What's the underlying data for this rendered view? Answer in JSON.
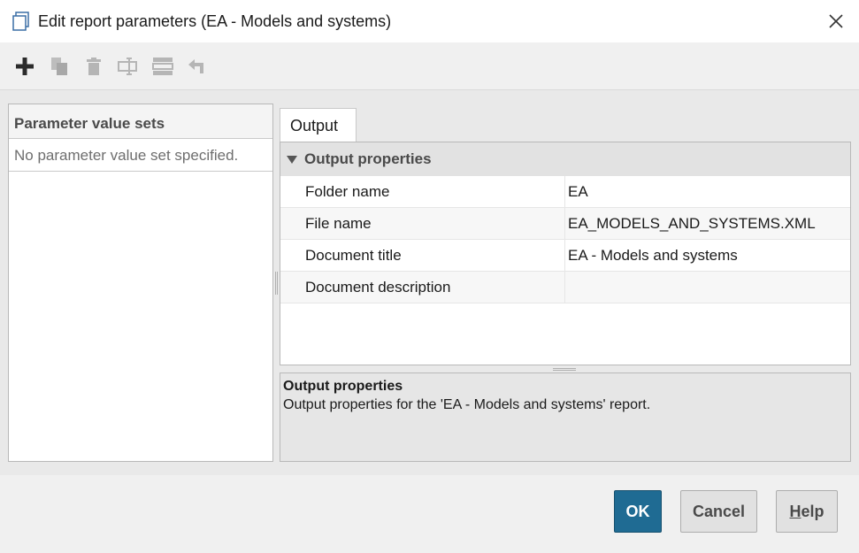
{
  "window": {
    "title": "Edit report parameters (EA - Models and systems)",
    "icon": "report-icon",
    "close_icon": "close-icon"
  },
  "toolbar": {
    "buttons": [
      {
        "name": "add-icon",
        "enabled": true
      },
      {
        "name": "copy-icon",
        "enabled": false
      },
      {
        "name": "delete-icon",
        "enabled": false
      },
      {
        "name": "rename-icon",
        "enabled": false
      },
      {
        "name": "default-icon",
        "enabled": false
      },
      {
        "name": "undo-icon",
        "enabled": false
      }
    ]
  },
  "left_panel": {
    "header": "Parameter value sets",
    "empty_text": "No parameter value set specified."
  },
  "tabs": [
    {
      "label": "Output",
      "active": true
    }
  ],
  "properties": {
    "category": "Output properties",
    "rows": [
      {
        "key": "Folder name",
        "value": "EA"
      },
      {
        "key": "File name",
        "value": "EA_MODELS_AND_SYSTEMS.XML"
      },
      {
        "key": "Document title",
        "value": "EA - Models and systems"
      },
      {
        "key": "Document description",
        "value": ""
      }
    ]
  },
  "description": {
    "title": "Output properties",
    "text": "Output properties for the 'EA - Models and systems' report."
  },
  "buttons": {
    "ok": "OK",
    "cancel": "Cancel",
    "help_mnemonic": "H",
    "help_rest": "elp"
  },
  "colors": {
    "ok_bg": "#1f6b93",
    "category_bg": "#e2e2e2"
  }
}
